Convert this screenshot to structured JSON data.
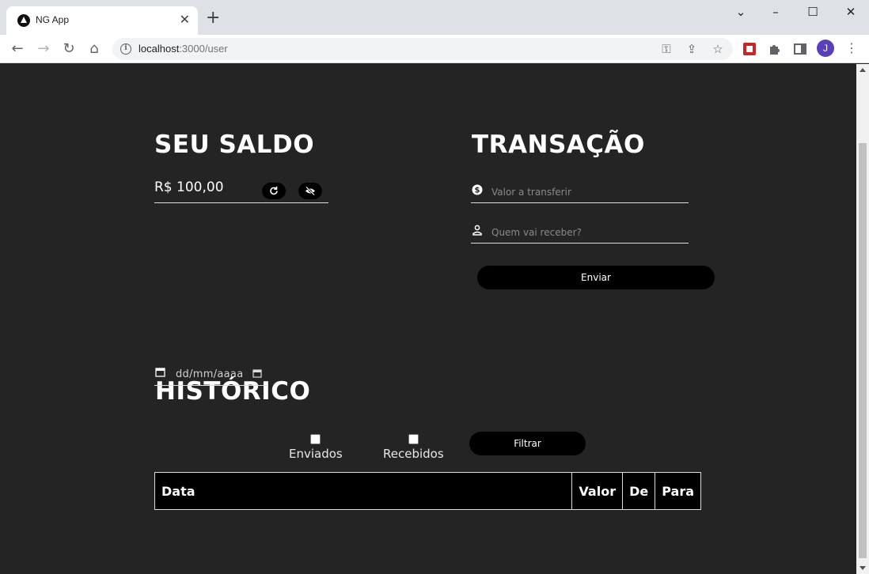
{
  "browser": {
    "tab_title": "NG App",
    "url_host": "localhost",
    "url_path": ":3000/user",
    "avatar_initial": "J"
  },
  "balance": {
    "heading": "SEU SALDO",
    "value": "R$ 100,00"
  },
  "transaction": {
    "heading": "TRANSAÇÃO",
    "amount_placeholder": "Valor a transferir",
    "recipient_placeholder": "Quem vai receber?",
    "send_label": "Enviar"
  },
  "history": {
    "heading": "HISTÓRICO",
    "date_placeholder": "dd/mm/aaaa",
    "sent_label": "Enviados",
    "received_label": "Recebidos",
    "filter_label": "Filtrar",
    "columns": [
      "Data",
      "Valor",
      "De",
      "Para"
    ]
  },
  "colors": {
    "page_bg": "#242424",
    "button_bg": "#000000",
    "text": "#ffffff"
  }
}
